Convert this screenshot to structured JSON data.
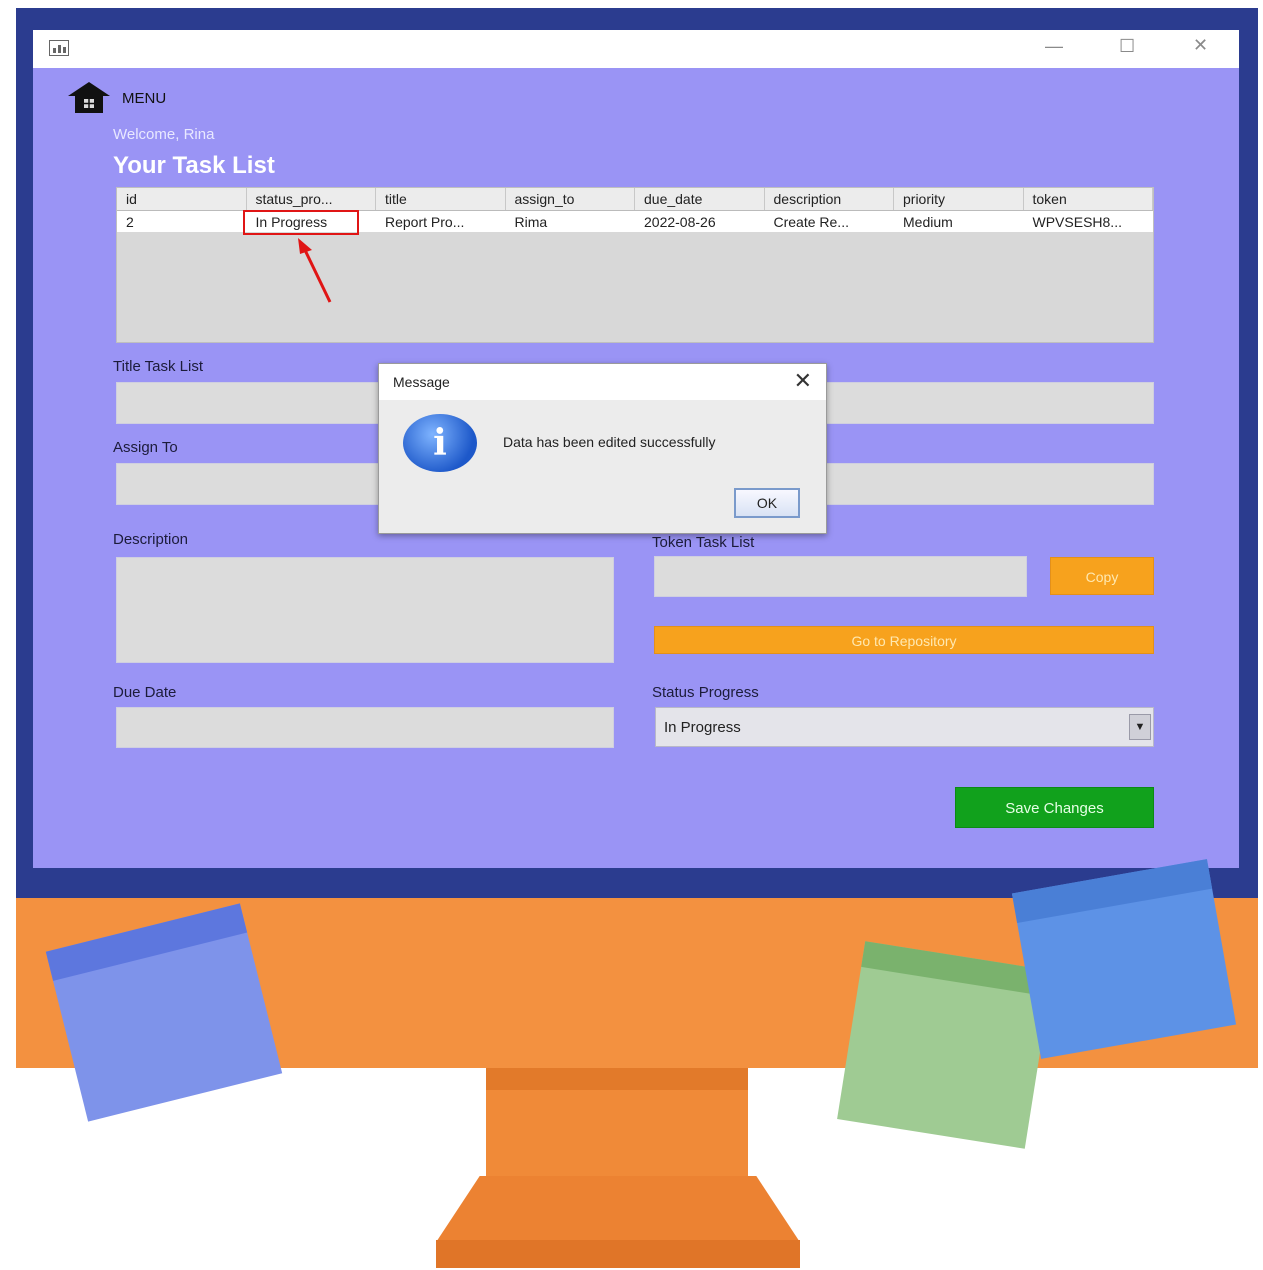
{
  "menu": {
    "label": "MENU"
  },
  "header": {
    "welcome": "Welcome, Rina",
    "title": "Your Task List"
  },
  "table": {
    "columns": [
      "id",
      "status_pro...",
      "title",
      "assign_to",
      "due_date",
      "description",
      "priority",
      "token"
    ],
    "rows": [
      [
        "2",
        "In Progress",
        "Report Pro...",
        "Rima",
        "2022-08-26",
        "Create Re...",
        "Medium",
        "WPVSESH8..."
      ]
    ]
  },
  "form": {
    "title_label": "Title Task List",
    "assign_label": "Assign To",
    "description_label": "Description",
    "due_label": "Due Date",
    "token_label": "Token Task List",
    "status_label": "Status Progress",
    "status_value": "In Progress",
    "copy_label": "Copy",
    "repo_label": "Go to Repository",
    "save_label": "Save Changes"
  },
  "dialog": {
    "title": "Message",
    "message": "Data has been edited successfully",
    "ok_label": "OK"
  },
  "colors": {
    "screen_bg": "#9a94f5",
    "save_button": "#11a11c",
    "orange_button": "#f7a21d",
    "highlight": "#e01515",
    "monitor_frame": "#2b3c8f",
    "monitor_body": "#f39140"
  },
  "icons": [
    "home-icon",
    "app-icon",
    "minimize-icon",
    "maximize-icon",
    "close-icon",
    "info-icon",
    "dropdown-arrow-icon",
    "arrow-annotation-icon"
  ]
}
